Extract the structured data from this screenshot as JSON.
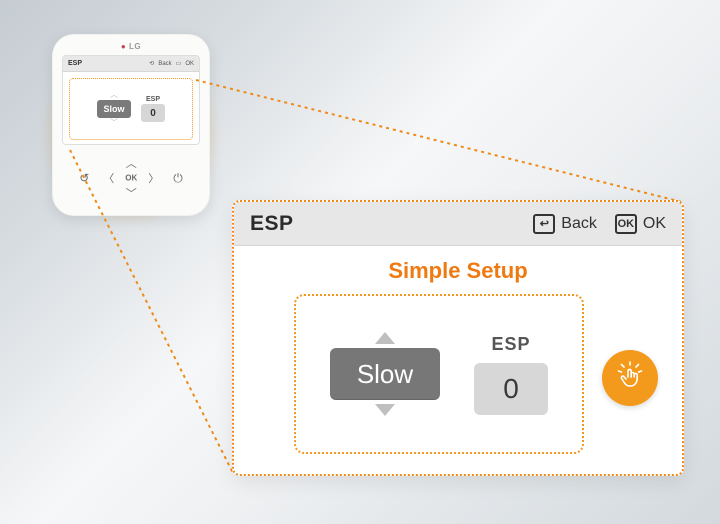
{
  "brand": "LG",
  "header": {
    "title": "ESP",
    "back_label": "Back",
    "ok_label": "OK",
    "back_glyph": "↩",
    "ok_glyph": "OK"
  },
  "subtitle": "Simple Setup",
  "speed": {
    "value": "Slow"
  },
  "esp": {
    "label": "ESP",
    "value": "0"
  },
  "hw": {
    "ok": "OK"
  },
  "colors": {
    "accent": "#ef7a12",
    "dash": "#f29a1f",
    "pill": "#777777",
    "esp_bg": "#d6d7d6"
  }
}
